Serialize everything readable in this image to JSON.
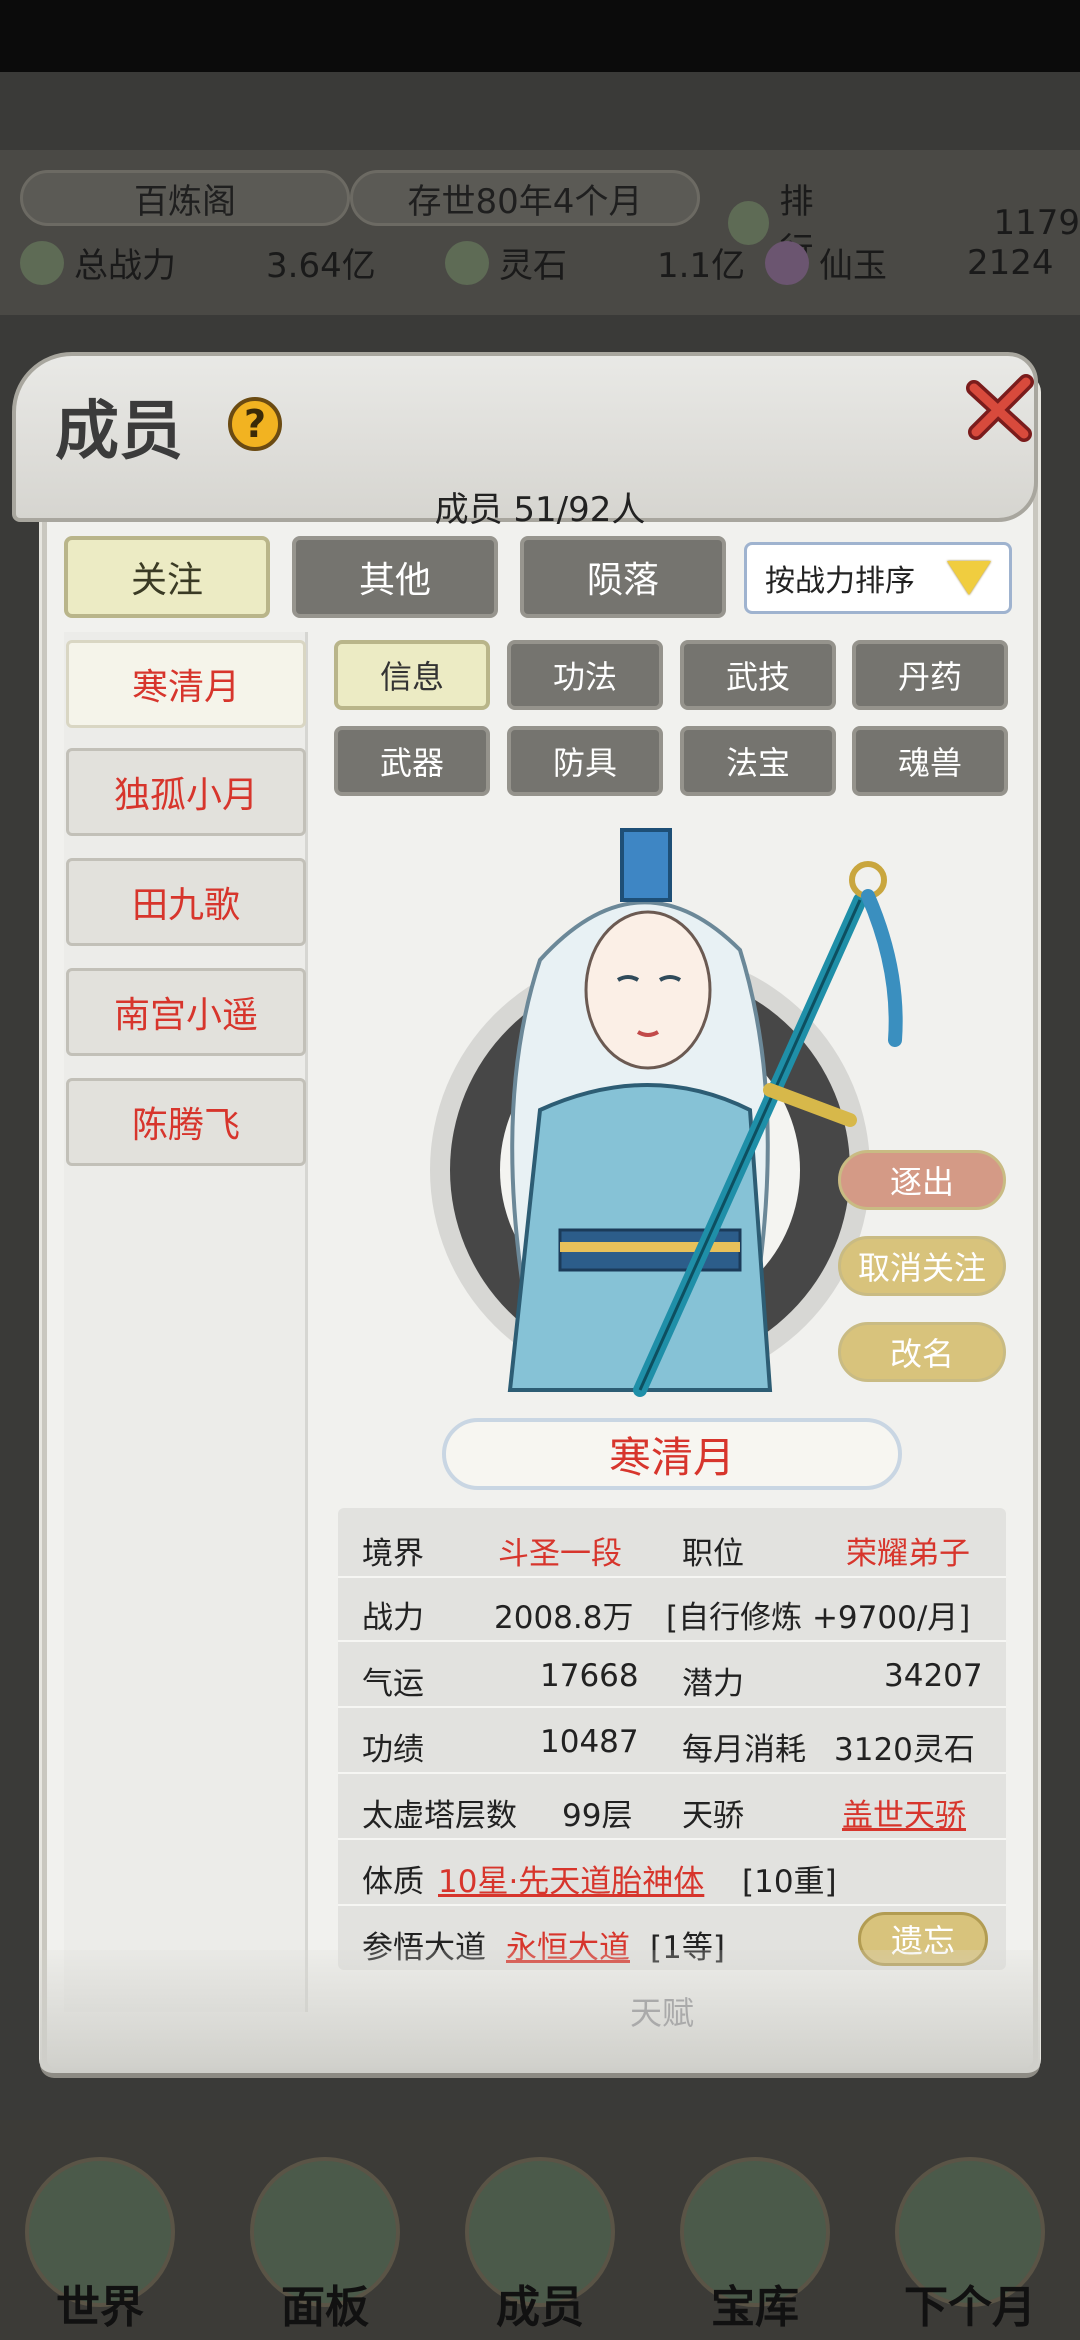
{
  "topbar": {
    "sect_name": "百炼阁",
    "era": "存世80年4个月",
    "rank_label": "排行",
    "rank_value": "1179",
    "power_label": "总战力",
    "power_value": "3.64亿",
    "spirit_stone_label": "灵石",
    "spirit_stone_value": "1.1亿",
    "jade_label": "仙玉",
    "jade_value": "2124"
  },
  "modal": {
    "title": "成员",
    "help_icon": "?",
    "member_count": "成员  51/92人",
    "tabs": [
      "关注",
      "其他",
      "陨落"
    ],
    "sort_label": "按战力排序"
  },
  "members": [
    "寒清月",
    "独孤小月",
    "田九歌",
    "南宫小遥",
    "陈腾飞"
  ],
  "subtabs": [
    "信息",
    "功法",
    "武技",
    "丹药",
    "武器",
    "防具",
    "法宝",
    "魂兽"
  ],
  "actions": {
    "expel": "逐出",
    "unfollow": "取消关注",
    "rename": "改名",
    "forget": "遗忘"
  },
  "selected": {
    "name": "寒清月",
    "realm_label": "境界",
    "realm": "斗圣一段",
    "position_label": "职位",
    "position": "荣耀弟子",
    "power_label": "战力",
    "power": "2008.8万",
    "cultivation": "[自行修炼 +9700/月]",
    "luck_label": "气运",
    "luck": "17668",
    "potential_label": "潜力",
    "potential": "34207",
    "merit_label": "功绩",
    "merit": "10487",
    "upkeep_label": "每月消耗",
    "upkeep": "3120灵石",
    "tower_label": "太虚塔层数",
    "tower": "99层",
    "prodigy_label": "天骄",
    "prodigy": "盖世天骄",
    "physique_label": "体质",
    "physique": "10星·先天道胎神体",
    "physique_level": "[10重]",
    "dao_label": "参悟大道",
    "dao": "永恒大道",
    "dao_level": "[1等]",
    "talent_ghost": "天赋"
  },
  "bottom_nav": [
    "世界",
    "面板",
    "成员",
    "宝库",
    "下个月"
  ],
  "colors": {
    "accent_red": "#d7352c",
    "tab_active": "#ecebc4",
    "tab_inactive": "#75746f"
  }
}
